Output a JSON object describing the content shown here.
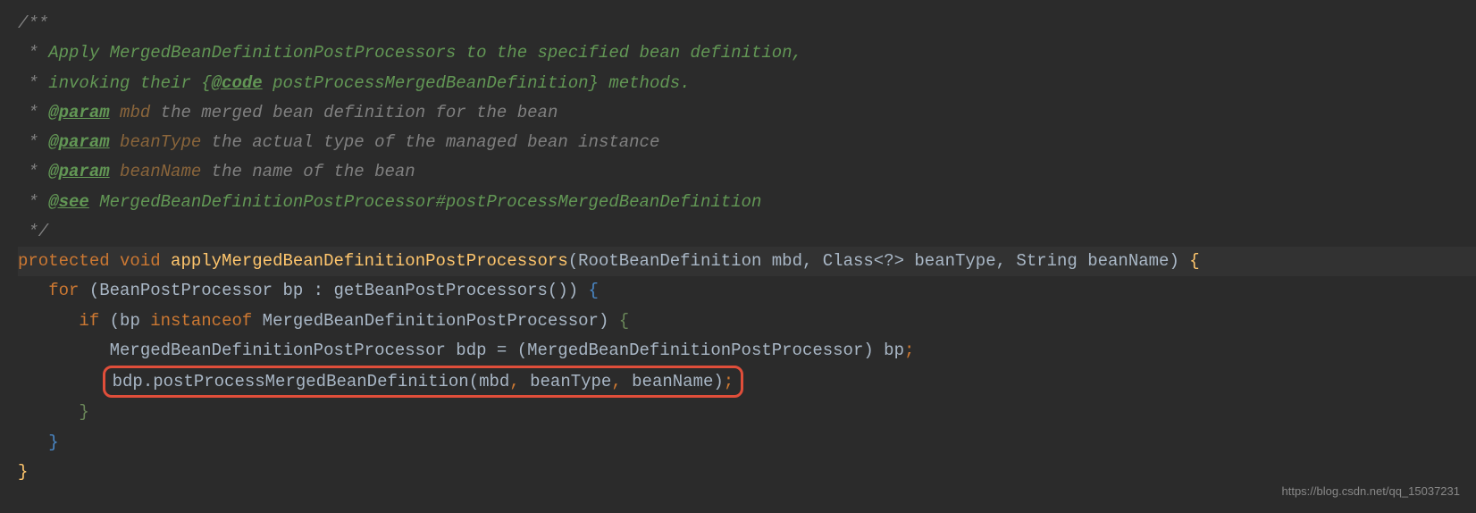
{
  "javadoc": {
    "open": "/**",
    "line1_prefix": " * ",
    "line1": "Apply MergedBeanDefinitionPostProcessors to the specified bean definition,",
    "line2_prefix": " * ",
    "line2_a": "invoking their ",
    "line2_code_open": "{",
    "line2_code_tag": "@code",
    "line2_code_body": " postProcessMergedBeanDefinition",
    "line2_code_close": "}",
    "line2_b": " methods.",
    "param_tag": "@param",
    "param1_name": "mbd",
    "param1_desc": " the merged bean definition for the bean",
    "param2_name": "beanType",
    "param2_desc": " the actual type of the managed bean instance",
    "param3_name": "beanName",
    "param3_desc": " the name of the bean",
    "see_tag": "@see",
    "see_desc": " MergedBeanDefinitionPostProcessor#postProcessMergedBeanDefinition",
    "close": " */"
  },
  "code": {
    "protected": "protected",
    "void": "void",
    "method": "applyMergedBeanDefinitionPostProcessors",
    "params": "(RootBeanDefinition mbd, Class<?> beanType, String beanName) ",
    "lbrace": "{",
    "for_kw": "for",
    "for_rest": " (BeanPostProcessor bp : getBeanPostProcessors()) ",
    "for_lbrace": "{",
    "if_kw": "if",
    "if_open": " (bp ",
    "instanceof_kw": "instanceof",
    "if_rest": " MergedBeanDefinitionPostProcessor) ",
    "if_lbrace": "{",
    "assign_line": "MergedBeanDefinitionPostProcessor bdp = (MergedBeanDefinitionPostProcessor) bp",
    "assign_semi": ";",
    "call_obj": "bdp.postProcessMergedBeanDefinition(mbd",
    "comma1": ",",
    "call_p2": " beanType",
    "comma2": ",",
    "call_p3": " beanName)",
    "call_semi": ";",
    "if_rbrace": "}",
    "for_rbrace": "}",
    "rbrace": "}"
  },
  "watermark": "https://blog.csdn.net/qq_15037231"
}
